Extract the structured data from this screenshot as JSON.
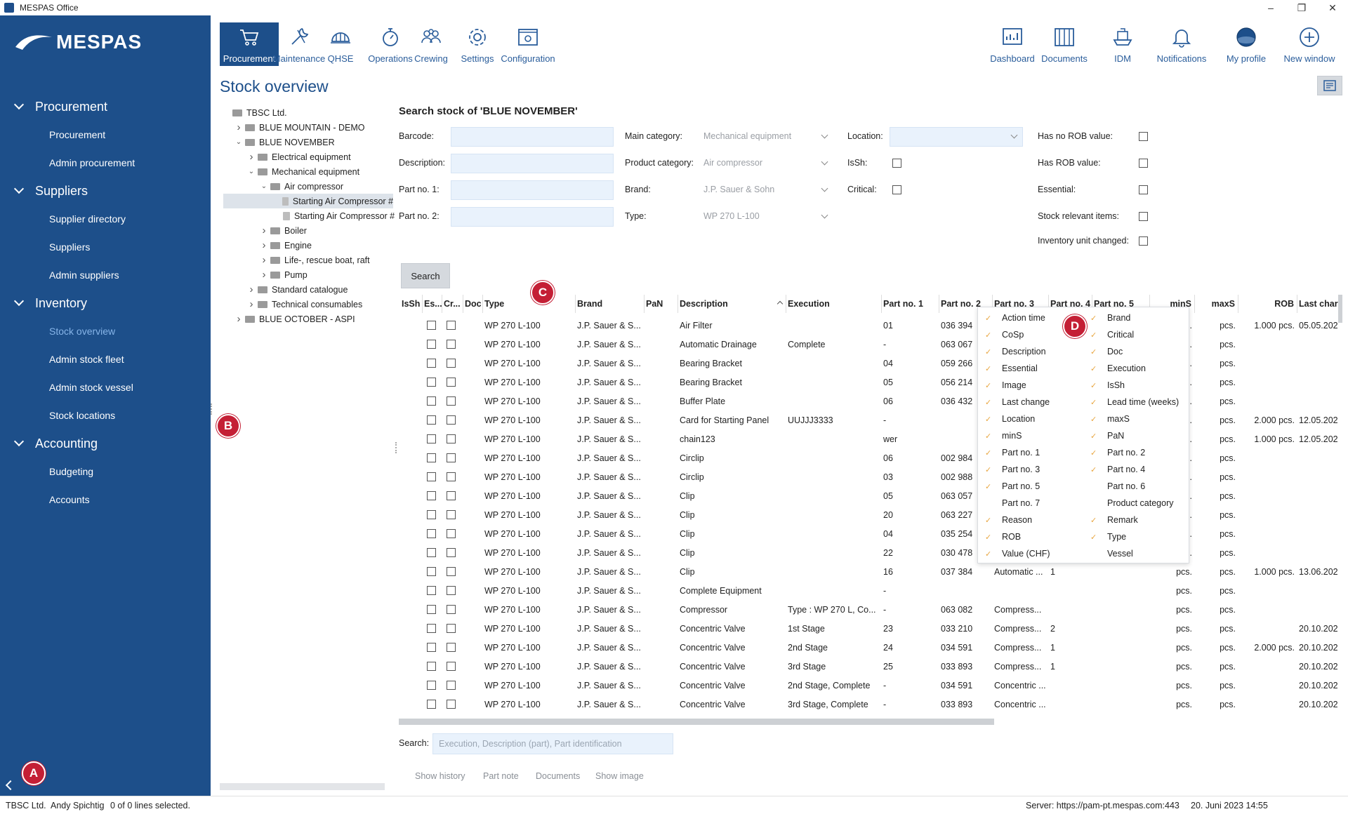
{
  "window": {
    "title": "MESPAS Office",
    "controls": [
      "–",
      "❐",
      "✕"
    ]
  },
  "brand": {
    "logo": "MESPAS"
  },
  "sidebar": {
    "sections": [
      {
        "label": "Procurement",
        "items": [
          "Procurement",
          "Admin procurement"
        ]
      },
      {
        "label": "Suppliers",
        "items": [
          "Supplier directory",
          "Suppliers",
          "Admin suppliers"
        ]
      },
      {
        "label": "Inventory",
        "items": [
          "Stock overview",
          "Admin stock fleet",
          "Admin stock vessel",
          "Stock locations"
        ]
      },
      {
        "label": "Accounting",
        "items": [
          "Budgeting",
          "Accounts"
        ]
      }
    ],
    "active_item": "Stock overview"
  },
  "toolbar": {
    "left": [
      {
        "label": "Procurement",
        "icon": "cart-icon"
      },
      {
        "label": "Maintenance",
        "icon": "wrench-icon"
      },
      {
        "label": "QHSE",
        "icon": "helmet-icon"
      },
      {
        "label": "Operations",
        "icon": "stopwatch-icon"
      },
      {
        "label": "Crewing",
        "icon": "people-icon"
      },
      {
        "label": "Settings",
        "icon": "gear-icon"
      },
      {
        "label": "Configuration",
        "icon": "config-icon"
      }
    ],
    "right": [
      {
        "label": "Dashboard",
        "icon": "dashboard-icon"
      },
      {
        "label": "Documents",
        "icon": "documents-icon"
      },
      {
        "label": "IDM",
        "icon": "ship-icon"
      },
      {
        "label": "Notifications",
        "icon": "bell-icon"
      },
      {
        "label": "My profile",
        "icon": "globe-avatar-icon"
      },
      {
        "label": "New window",
        "icon": "plus-circle-icon"
      }
    ]
  },
  "page": {
    "title": "Stock overview"
  },
  "tree": [
    {
      "label": "TBSC Ltd.",
      "depth": 0,
      "exp": "",
      "kind": "folder"
    },
    {
      "label": "BLUE MOUNTAIN - DEMO",
      "depth": 1,
      "exp": ">",
      "kind": "folder"
    },
    {
      "label": "BLUE NOVEMBER",
      "depth": 1,
      "exp": "v",
      "kind": "folder"
    },
    {
      "label": "Electrical equipment",
      "depth": 2,
      "exp": ">",
      "kind": "folder"
    },
    {
      "label": "Mechanical equipment",
      "depth": 2,
      "exp": "v",
      "kind": "folder"
    },
    {
      "label": "Air compressor",
      "depth": 3,
      "exp": "v",
      "kind": "folder"
    },
    {
      "label": "Starting Air Compressor #",
      "depth": 4,
      "exp": "",
      "kind": "doc",
      "selected": true
    },
    {
      "label": "Starting Air Compressor #",
      "depth": 4,
      "exp": "",
      "kind": "doc"
    },
    {
      "label": "Boiler",
      "depth": 3,
      "exp": ">",
      "kind": "folder"
    },
    {
      "label": "Engine",
      "depth": 3,
      "exp": ">",
      "kind": "folder"
    },
    {
      "label": "Life-, rescue boat, raft",
      "depth": 3,
      "exp": ">",
      "kind": "folder"
    },
    {
      "label": "Pump",
      "depth": 3,
      "exp": ">",
      "kind": "folder"
    },
    {
      "label": "Standard catalogue",
      "depth": 2,
      "exp": ">",
      "kind": "folder"
    },
    {
      "label": "Technical consumables",
      "depth": 2,
      "exp": ">",
      "kind": "folder"
    },
    {
      "label": "BLUE OCTOBER - ASPI",
      "depth": 1,
      "exp": ">",
      "kind": "folder"
    }
  ],
  "search": {
    "title": "Search stock of 'BLUE NOVEMBER'",
    "barcode_label": "Barcode:",
    "description_label": "Description:",
    "partno1_label": "Part no. 1:",
    "partno2_label": "Part no. 2:",
    "main_category_label": "Main category:",
    "main_category_value": "Mechanical equipment",
    "product_category_label": "Product category:",
    "product_category_value": "Air compressor",
    "brand_label": "Brand:",
    "brand_value": "J.P. Sauer & Sohn",
    "type_label": "Type:",
    "type_value": "WP 270 L-100",
    "location_label": "Location:",
    "issh_label": "IsSh:",
    "critical_label": "Critical:",
    "no_rob_label": "Has no ROB value:",
    "has_rob_label": "Has ROB value:",
    "essential_label": "Essential:",
    "stock_relevant_label": "Stock relevant items:",
    "inventory_changed_label": "Inventory unit changed:",
    "button": "Search"
  },
  "grid": {
    "columns": [
      "IsSh",
      "Es...",
      "Cr...",
      "Doc",
      "Type",
      "Brand",
      "PaN",
      "Description",
      "Execution",
      "Part no. 1",
      "Part no. 2",
      "Part no. 3",
      "Part no. 4",
      "Part no. 5",
      "minS",
      "maxS",
      "ROB",
      "Last char"
    ],
    "rows": [
      [
        "WP 270 L-100",
        "J.P. Sauer & S...",
        "Air Filter",
        "",
        "01",
        "036 394",
        "",
        "",
        "pcs.",
        "pcs.",
        "1.000 pcs.",
        "05.05.202"
      ],
      [
        "WP 270 L-100",
        "J.P. Sauer & S...",
        "Automatic Drainage",
        "Complete",
        "-",
        "063 067",
        "",
        "",
        "pcs.",
        "pcs.",
        "",
        ""
      ],
      [
        "WP 270 L-100",
        "J.P. Sauer & S...",
        "Bearing Bracket",
        "",
        "04",
        "059 266",
        "",
        "",
        "pcs.",
        "pcs.",
        "",
        ""
      ],
      [
        "WP 270 L-100",
        "J.P. Sauer & S...",
        "Bearing Bracket",
        "",
        "05",
        "056 214",
        "",
        "",
        "pcs.",
        "pcs.",
        "",
        ""
      ],
      [
        "WP 270 L-100",
        "J.P. Sauer & S...",
        "Buffer Plate",
        "",
        "06",
        "036 432",
        "",
        "",
        "pcs.",
        "pcs.",
        "",
        ""
      ],
      [
        "WP 270 L-100",
        "J.P. Sauer & S...",
        "Card for Starting Panel",
        "UUJJJ3333",
        "-",
        "",
        "",
        "",
        "pcs.",
        "pcs.",
        "2.000 pcs.",
        "12.05.202"
      ],
      [
        "WP 270 L-100",
        "J.P. Sauer & S...",
        "chain123",
        "",
        "wer",
        "",
        "",
        "",
        "pcs.",
        "pcs.",
        "1.000 pcs.",
        "12.05.202"
      ],
      [
        "WP 270 L-100",
        "J.P. Sauer & S...",
        "Circlip",
        "",
        "06",
        "002 984",
        "",
        "",
        "pcs.",
        "pcs.",
        "",
        ""
      ],
      [
        "WP 270 L-100",
        "J.P. Sauer & S...",
        "Circlip",
        "",
        "03",
        "002 988",
        "",
        "",
        "pcs.",
        "pcs.",
        "",
        ""
      ],
      [
        "WP 270 L-100",
        "J.P. Sauer & S...",
        "Clip",
        "",
        "05",
        "063 057",
        "",
        "",
        "pcs.",
        "pcs.",
        "",
        ""
      ],
      [
        "WP 270 L-100",
        "J.P. Sauer & S...",
        "Clip",
        "",
        "20",
        "063 227",
        "",
        "",
        "pcs.",
        "pcs.",
        "",
        ""
      ],
      [
        "WP 270 L-100",
        "J.P. Sauer & S...",
        "Clip",
        "",
        "04",
        "035 254",
        "",
        "",
        "pcs.",
        "pcs.",
        "",
        ""
      ],
      [
        "WP 270 L-100",
        "J.P. Sauer & S...",
        "Clip",
        "",
        "22",
        "030 478",
        "",
        "",
        "pcs.",
        "pcs.",
        "",
        ""
      ],
      [
        "WP 270 L-100",
        "J.P. Sauer & S...",
        "Clip",
        "",
        "16",
        "037 384",
        "Automatic ...",
        "1",
        "pcs.",
        "pcs.",
        "1.000 pcs.",
        "13.06.202"
      ],
      [
        "WP 270 L-100",
        "J.P. Sauer & S...",
        "Complete Equipment",
        "",
        "-",
        "",
        "",
        "",
        "pcs.",
        "pcs.",
        "",
        ""
      ],
      [
        "WP 270 L-100",
        "J.P. Sauer & S...",
        "Compressor",
        "Type : WP 270 L, Co...",
        "-",
        "063 082",
        "Compress...",
        "",
        "pcs.",
        "pcs.",
        "",
        ""
      ],
      [
        "WP 270 L-100",
        "J.P. Sauer & S...",
        "Concentric Valve",
        "1st Stage",
        "23",
        "033 210",
        "Compress...",
        "2",
        "pcs.",
        "pcs.",
        "",
        "20.10.202"
      ],
      [
        "WP 270 L-100",
        "J.P. Sauer & S...",
        "Concentric Valve",
        "2nd Stage",
        "24",
        "034 591",
        "Compress...",
        "1",
        "pcs.",
        "pcs.",
        "2.000 pcs.",
        "20.10.202"
      ],
      [
        "WP 270 L-100",
        "J.P. Sauer & S...",
        "Concentric Valve",
        "3rd Stage",
        "25",
        "033 893",
        "Compress...",
        "1",
        "pcs.",
        "pcs.",
        "",
        "20.10.202"
      ],
      [
        "WP 270 L-100",
        "J.P. Sauer & S...",
        "Concentric Valve",
        "2nd Stage, Complete",
        "-",
        "034 591",
        "Concentric ...",
        "",
        "pcs.",
        "pcs.",
        "",
        "20.10.202"
      ],
      [
        "WP 270 L-100",
        "J.P. Sauer & S...",
        "Concentric Valve",
        "3rd Stage, Complete",
        "-",
        "033 893",
        "Concentric ...",
        "",
        "pcs.",
        "pcs.",
        "",
        "20.10.202"
      ]
    ]
  },
  "column_chooser": {
    "left": [
      {
        "label": "Action time",
        "checked": true
      },
      {
        "label": "CoSp",
        "checked": true
      },
      {
        "label": "Description",
        "checked": true
      },
      {
        "label": "Essential",
        "checked": true
      },
      {
        "label": "Image",
        "checked": true
      },
      {
        "label": "Last change",
        "checked": true
      },
      {
        "label": "Location",
        "checked": true
      },
      {
        "label": "minS",
        "checked": true
      },
      {
        "label": "Part no. 1",
        "checked": true
      },
      {
        "label": "Part no. 3",
        "checked": true
      },
      {
        "label": "Part no. 5",
        "checked": true
      },
      {
        "label": "Part no. 7",
        "checked": false
      },
      {
        "label": "Reason",
        "checked": true
      },
      {
        "label": "ROB",
        "checked": true
      },
      {
        "label": "Value (CHF)",
        "checked": true
      }
    ],
    "right": [
      {
        "label": "Brand",
        "checked": true
      },
      {
        "label": "Critical",
        "checked": true
      },
      {
        "label": "Doc",
        "checked": true
      },
      {
        "label": "Execution",
        "checked": true
      },
      {
        "label": "IsSh",
        "checked": true
      },
      {
        "label": "Lead time (weeks)",
        "checked": true
      },
      {
        "label": "maxS",
        "checked": true
      },
      {
        "label": "PaN",
        "checked": true
      },
      {
        "label": "Part no. 2",
        "checked": true
      },
      {
        "label": "Part no. 4",
        "checked": true
      },
      {
        "label": "Part no. 6",
        "checked": false
      },
      {
        "label": "Product category",
        "checked": false
      },
      {
        "label": "Remark",
        "checked": true
      },
      {
        "label": "Type",
        "checked": true
      },
      {
        "label": "Vessel",
        "checked": false
      }
    ]
  },
  "bottom": {
    "search_label": "Search:",
    "search_placeholder": "Execution, Description (part), Part identification",
    "actions": [
      "Show history",
      "Part note",
      "Documents",
      "Show image"
    ]
  },
  "markers": [
    "A",
    "B",
    "C",
    "D"
  ],
  "status": {
    "company": "TBSC Ltd.",
    "user": "Andy Spichtig",
    "selection": "0 of 0 lines selected.",
    "server": "Server: https://pam-pt.mespas.com:443",
    "datetime": "20. Juni 2023 14:55"
  },
  "colors": {
    "sidebar": "#1d4f8a",
    "accent": "#2a5d9b",
    "marker": "#c41f35",
    "check": "#e8a640"
  }
}
